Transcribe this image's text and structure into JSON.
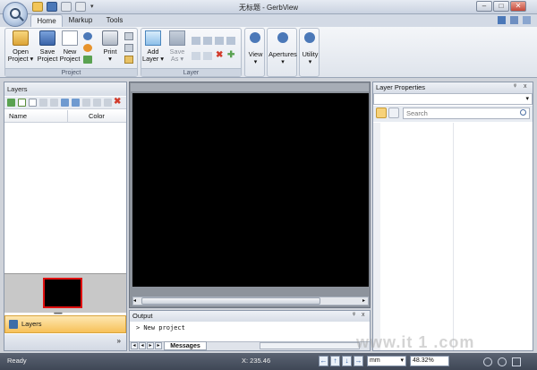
{
  "window": {
    "title": "无标题 - GerbView",
    "minimize": "–",
    "maximize": "□",
    "close": "✕"
  },
  "ribbon": {
    "tabs": [
      "Home",
      "Markup",
      "Tools"
    ],
    "groups": {
      "project": {
        "label": "Project",
        "open": "Open",
        "open2": "Project",
        "save": "Save",
        "save2": "Project",
        "new": "New",
        "new2": "Project",
        "print": "Print"
      },
      "layer": {
        "label": "Layer",
        "add": "Add",
        "add2": "Layer",
        "saveas": "Save",
        "saveas2": "As"
      },
      "view": {
        "label": "View"
      },
      "apertures": {
        "label": "Apertures"
      },
      "utility": {
        "label": "Utility"
      }
    }
  },
  "layers_panel": {
    "title": "Layers",
    "columns": [
      "Name",
      "Color"
    ],
    "bar_label": "Layers",
    "more": "»"
  },
  "output_panel": {
    "title": "Output",
    "text": "> New project",
    "tab": "Messages",
    "pin": "ᵠ",
    "close": "x"
  },
  "properties_panel": {
    "title": "Layer Properties",
    "search_placeholder": "Search",
    "pin": "ᵠ",
    "close": "x"
  },
  "statusbar": {
    "ready": "Ready",
    "coord": "X: 235.46",
    "unit": "mm",
    "zoom": "48.32%"
  },
  "watermark": "www.it 1  .com",
  "colors": {
    "accent": "#f7c159",
    "canvas": "#000000",
    "statusbar": "#4a5260"
  }
}
